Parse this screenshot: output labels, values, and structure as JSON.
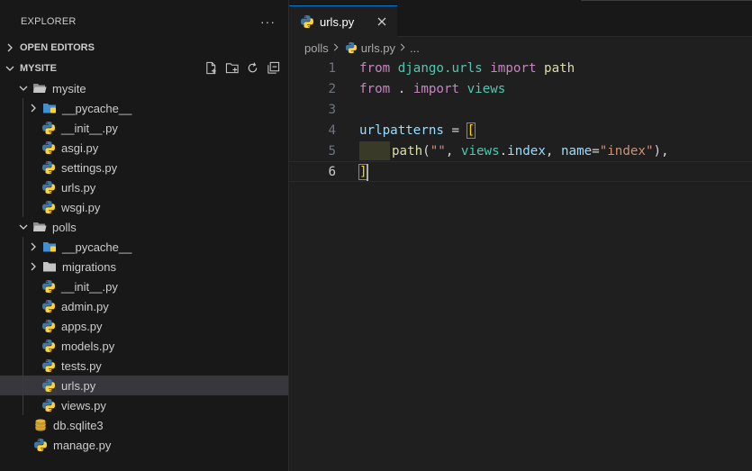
{
  "sidebar": {
    "title": "EXPLORER",
    "more_label": "···",
    "open_editors": "OPEN EDITORS",
    "project": "MYSITE",
    "actions": [
      "new-file-icon",
      "new-folder-icon",
      "refresh-icon",
      "collapse-all-icon"
    ],
    "tree": [
      {
        "label": "mysite",
        "type": "folder-open",
        "depth": 1
      },
      {
        "label": "__pycache__",
        "type": "folder-pycache",
        "depth": 2
      },
      {
        "label": "__init__.py",
        "type": "python",
        "depth": 2
      },
      {
        "label": "asgi.py",
        "type": "python",
        "depth": 2
      },
      {
        "label": "settings.py",
        "type": "python",
        "depth": 2
      },
      {
        "label": "urls.py",
        "type": "python",
        "depth": 2
      },
      {
        "label": "wsgi.py",
        "type": "python",
        "depth": 2
      },
      {
        "label": "polls",
        "type": "folder-open",
        "depth": 1
      },
      {
        "label": "__pycache__",
        "type": "folder-pycache",
        "depth": 2
      },
      {
        "label": "migrations",
        "type": "folder",
        "depth": 2
      },
      {
        "label": "__init__.py",
        "type": "python",
        "depth": 2
      },
      {
        "label": "admin.py",
        "type": "python",
        "depth": 2
      },
      {
        "label": "apps.py",
        "type": "python",
        "depth": 2
      },
      {
        "label": "models.py",
        "type": "python",
        "depth": 2
      },
      {
        "label": "tests.py",
        "type": "python",
        "depth": 2
      },
      {
        "label": "urls.py",
        "type": "python",
        "depth": 2,
        "selected": true
      },
      {
        "label": "views.py",
        "type": "python",
        "depth": 2
      },
      {
        "label": "db.sqlite3",
        "type": "database",
        "depth": 1
      },
      {
        "label": "manage.py",
        "type": "python",
        "depth": 1
      }
    ]
  },
  "editor": {
    "tab": {
      "label": "urls.py",
      "close": "×"
    },
    "breadcrumb": {
      "folder": "polls",
      "file": "urls.py",
      "tail": "..."
    },
    "line_numbers": [
      "1",
      "2",
      "3",
      "4",
      "5",
      "6"
    ],
    "code": {
      "l1": {
        "kw1": "from",
        "mod": "django.urls",
        "kw2": "import",
        "name": "path"
      },
      "l2": {
        "kw1": "from",
        "dot": ".",
        "kw2": "import",
        "name": "views"
      },
      "l4": {
        "var": "urlpatterns",
        "op": " = ",
        "bracket": "["
      },
      "l5": {
        "fn": "path",
        "p1": "(",
        "str1": "\"\"",
        "c1": ", ",
        "obj": "views",
        "dot": ".",
        "attr": "index",
        "c2": ", ",
        "kwarg": "name",
        "eq": "=",
        "str2": "\"index\"",
        "p2": ")",
        "c3": ","
      },
      "l6": {
        "bracket": "]"
      }
    }
  },
  "colors": {
    "accent": "#0078d4",
    "python_blue": "#3c78aa",
    "python_yellow": "#ffd43b",
    "folder": "#c5c5c5",
    "pycache_folder": "#3f8fd6",
    "db": "#e2b33b"
  }
}
